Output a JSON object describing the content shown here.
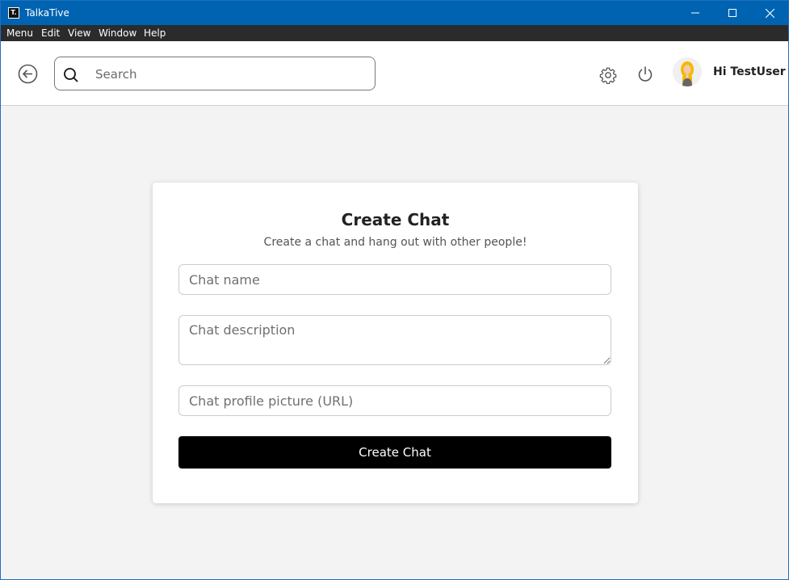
{
  "window": {
    "title": "TalkaTive",
    "app_icon_glyph": "T."
  },
  "menubar": {
    "items": [
      "Menu",
      "Edit",
      "View",
      "Window",
      "Help"
    ]
  },
  "header": {
    "search_placeholder": "Search",
    "greeting": "Hi TestUser",
    "icons": [
      "back-arrow-icon",
      "search-icon",
      "gear-icon",
      "power-icon",
      "avatar"
    ]
  },
  "card": {
    "title": "Create Chat",
    "subtitle": "Create a chat and hang out with other people!",
    "name_placeholder": "Chat name",
    "description_placeholder": "Chat description",
    "picture_placeholder": "Chat profile picture (URL)",
    "submit_label": "Create Chat"
  },
  "colors": {
    "titlebar": "#0063b1",
    "menubar": "#2b2b2b",
    "background": "#f3f3f3",
    "button": "#000000"
  }
}
